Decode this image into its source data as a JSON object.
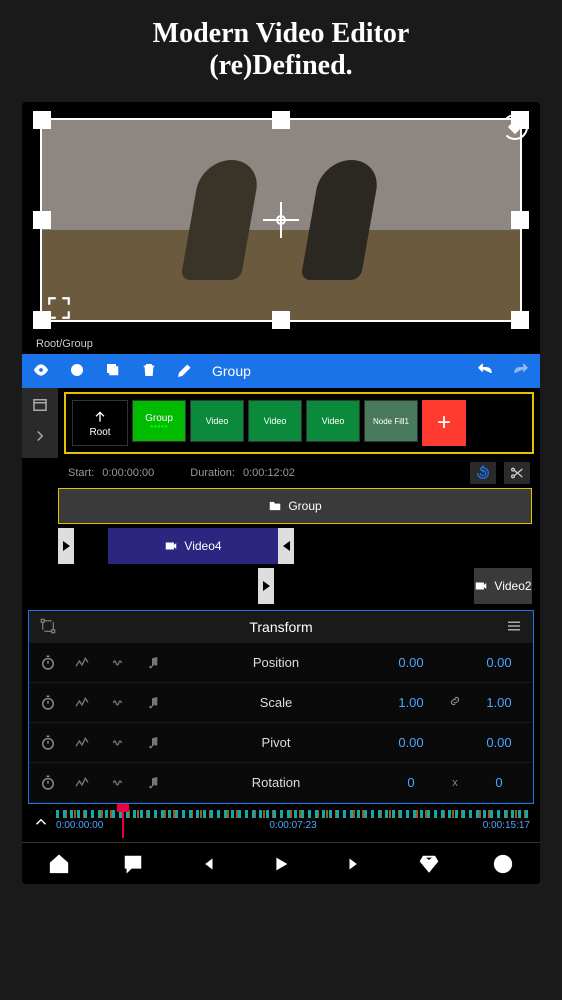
{
  "marketing": {
    "line1": "Modern Video Editor",
    "line2": "(re)Defined."
  },
  "breadcrumb": "Root/Group",
  "toolbar": {
    "group_label": "Group"
  },
  "media": {
    "root_label": "Root",
    "thumbs": [
      {
        "label": "Group"
      },
      {
        "label": "Video"
      },
      {
        "label": "Video"
      },
      {
        "label": "Video"
      },
      {
        "label": "Node Fill1"
      }
    ],
    "add_label": "+"
  },
  "timeinfo": {
    "start_label": "Start:",
    "start_value": "0:00:00:00",
    "duration_label": "Duration:",
    "duration_value": "0:00:12:02"
  },
  "tracks": {
    "group_label": "Group",
    "video4_label": "Video4",
    "video2_label": "Video2"
  },
  "panel": {
    "title": "Transform",
    "rows": [
      {
        "name": "Position",
        "v1": "0.00",
        "sep": "",
        "v2": "0.00"
      },
      {
        "name": "Scale",
        "v1": "1.00",
        "sep": "link",
        "v2": "1.00"
      },
      {
        "name": "Pivot",
        "v1": "0.00",
        "sep": "",
        "v2": "0.00"
      },
      {
        "name": "Rotation",
        "v1": "0",
        "sep": "x",
        "v2": "0"
      }
    ]
  },
  "ruler": {
    "t0": "0:00:00:00",
    "t1": "0:00:07:23",
    "t2": "0:00:15:17"
  }
}
